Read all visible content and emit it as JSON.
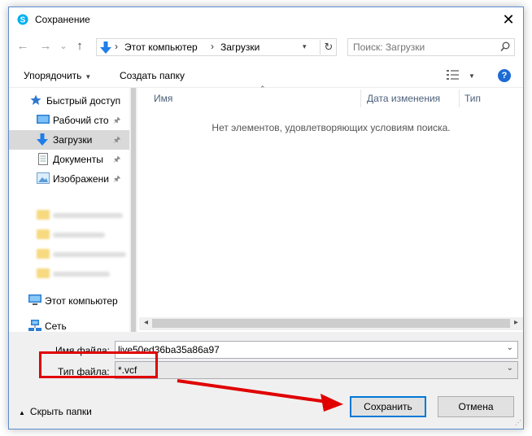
{
  "window": {
    "title": "Сохранение",
    "close_glyph": "✕"
  },
  "nav": {
    "back_glyph": "←",
    "forward_glyph": "→",
    "history_glyph": "⌄",
    "up_glyph": "↑",
    "breadcrumb": [
      "Этот компьютер",
      "Загрузки"
    ],
    "separator": "›",
    "search_placeholder": "Поиск: Загрузки"
  },
  "toolbar": {
    "organize_label": "Упорядочить",
    "new_folder_label": "Создать папку",
    "help_label": "?"
  },
  "sidebar": {
    "quick_access": "Быстрый доступ",
    "items": [
      {
        "label": "Рабочий сто",
        "icon": "desktop-icon",
        "pinned": true
      },
      {
        "label": "Загрузки",
        "icon": "download-icon",
        "pinned": true,
        "selected": true
      },
      {
        "label": "Документы",
        "icon": "documents-icon",
        "pinned": true
      },
      {
        "label": "Изображени",
        "icon": "pictures-icon",
        "pinned": true
      }
    ],
    "this_pc": "Этот компьютер",
    "network": "Сеть",
    "pin_glyph": "📌"
  },
  "file_list": {
    "columns": [
      "Имя",
      "Дата изменения",
      "Тип"
    ],
    "empty_message": "Нет элементов, удовлетворяющих условиям поиска."
  },
  "form": {
    "filename_label": "Имя файла:",
    "filename_value": "live50ed36ba35a86a97",
    "filetype_label": "Тип файла:",
    "filetype_value": "*.vcf",
    "hide_folders_label": "Скрыть папки",
    "save_label": "Сохранить",
    "cancel_label": "Отмена"
  },
  "colors": {
    "accent": "#0078d7",
    "annotation_red": "#e00000",
    "help_blue": "#1d6bd4"
  }
}
